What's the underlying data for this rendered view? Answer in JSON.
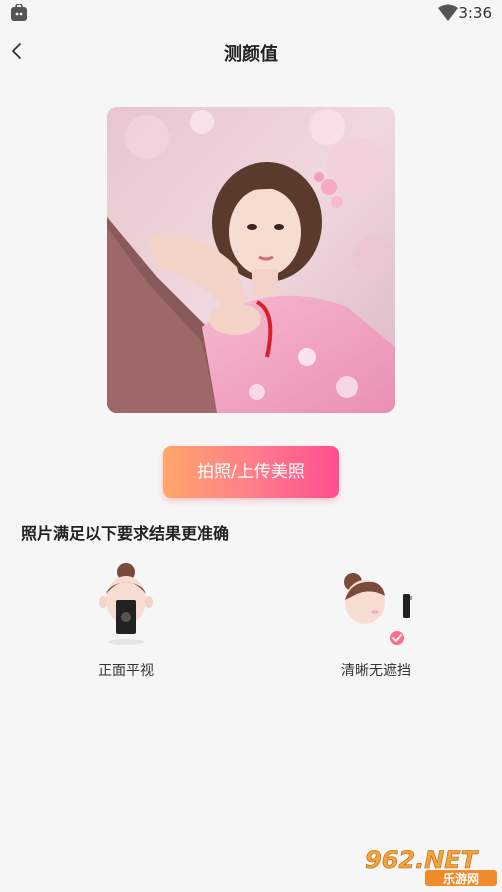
{
  "status_bar": {
    "time": "3:36",
    "icons": [
      "app-notification-icon",
      "wifi-icon",
      "battery-icon"
    ]
  },
  "header": {
    "back_icon": "chevron-left-icon",
    "title": "测颜值"
  },
  "main": {
    "photo": {
      "alt": "穿樱花和服的女孩",
      "type": "sample-portrait"
    },
    "upload_button_label": "拍照/上传美照",
    "requirements_title": "照片满足以下要求结果更准确",
    "requirements": [
      {
        "label": "正面平视",
        "icon": "front-face-phone-illustration"
      },
      {
        "label": "清晰无遮挡",
        "icon": "side-face-check-illustration"
      }
    ]
  },
  "watermark": {
    "text": "962.NET",
    "subtext": "乐游网"
  },
  "colors": {
    "button_gradient_start": "#ffa66a",
    "button_gradient_end": "#ff4e8f",
    "background": "#f6f6f6",
    "check_badge": "#ff6b8a"
  }
}
